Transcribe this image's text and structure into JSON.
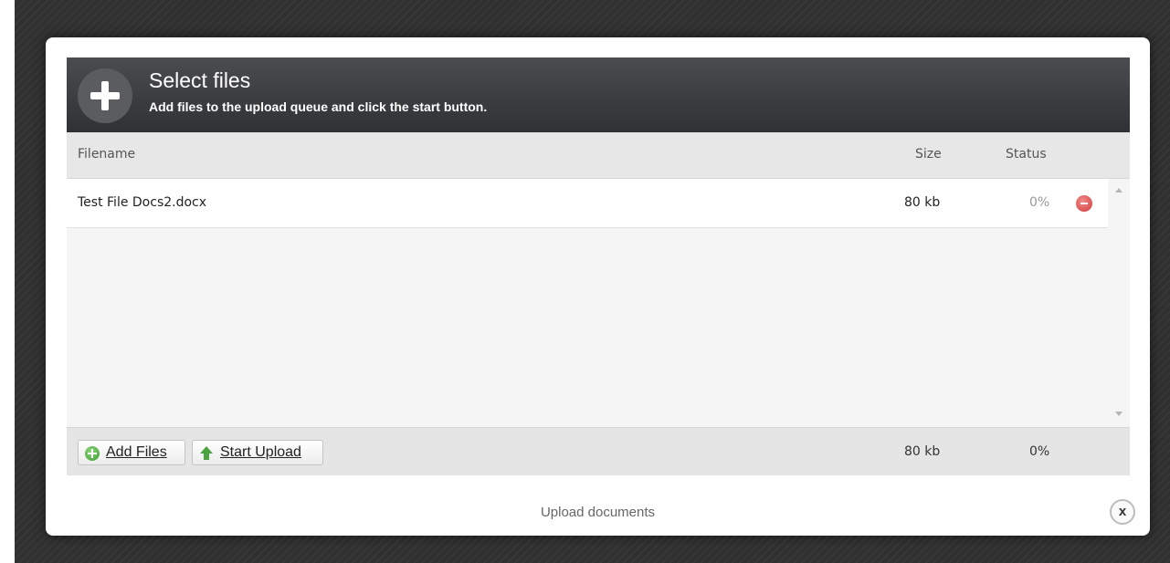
{
  "uploader": {
    "title": "Select files",
    "subtitle": "Add files to the upload queue and click the start button.",
    "columns": {
      "filename": "Filename",
      "size": "Size",
      "status": "Status"
    },
    "files": [
      {
        "name": "Test File Docs2.docx",
        "size": "80 kb",
        "status": "0%"
      }
    ],
    "buttons": {
      "add_files": "Add Files",
      "start_upload": "Start Upload"
    },
    "footer": {
      "total_size": "80 kb",
      "total_status": "0%"
    }
  },
  "modal": {
    "caption": "Upload documents",
    "close_label": "x"
  },
  "colors": {
    "header_bg": "#3a3c3f",
    "remove_icon": "#d94a4a",
    "add_icon": "#3d9a34"
  },
  "icons": [
    "plus-icon",
    "remove-file-icon",
    "add-files-icon",
    "upload-arrow-icon",
    "close-icon",
    "scroll-up-icon",
    "scroll-down-icon"
  ]
}
